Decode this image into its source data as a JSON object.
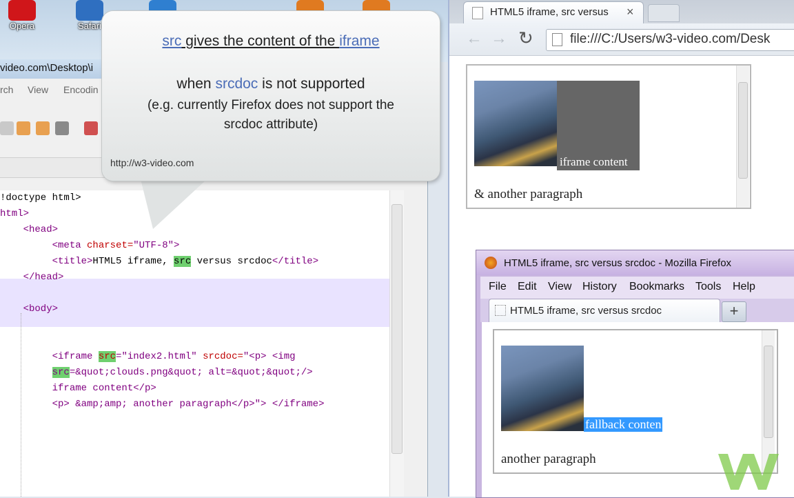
{
  "desktop": {
    "icons": [
      {
        "label": "Opera",
        "color": "#d0161a"
      },
      {
        "label": "Safari",
        "color": "#2f6fc0"
      },
      {
        "label": "",
        "color": "#2f7fd0"
      },
      {
        "label": "",
        "color": "#e07a20"
      },
      {
        "label": "",
        "color": "#e07a20"
      }
    ]
  },
  "editor": {
    "path": "video.com\\Desktop\\i",
    "menu": [
      "rch",
      "View",
      "Encodin"
    ],
    "code_lines": [
      {
        "parts": [
          {
            "t": "!doctype html>",
            "c": "txt"
          }
        ]
      },
      {
        "parts": [
          {
            "t": "html>",
            "c": "tag"
          }
        ]
      },
      {
        "parts": [
          {
            "t": "    <head>",
            "c": "tag"
          }
        ]
      },
      {
        "parts": [
          {
            "t": "         <meta ",
            "c": "tag"
          },
          {
            "t": "charset=",
            "c": "attr"
          },
          {
            "t": "\"UTF-8\">",
            "c": "val"
          }
        ]
      },
      {
        "parts": [
          {
            "t": "         <title>",
            "c": "tag"
          },
          {
            "t": "HTML5 iframe, ",
            "c": "txt"
          },
          {
            "t": "src",
            "c": "txt hl"
          },
          {
            "t": " versus srcdoc",
            "c": "txt"
          },
          {
            "t": "</title>",
            "c": "tag"
          }
        ]
      },
      {
        "parts": [
          {
            "t": "    </head>",
            "c": "tag"
          }
        ]
      },
      {
        "parts": [
          {
            "t": "",
            "c": "txt"
          }
        ]
      },
      {
        "parts": [
          {
            "t": "    <body>",
            "c": "tag"
          }
        ]
      },
      {
        "parts": [
          {
            "t": "",
            "c": "txt"
          }
        ]
      },
      {
        "parts": [
          {
            "t": "",
            "c": "txt"
          }
        ]
      },
      {
        "parts": [
          {
            "t": "         <iframe ",
            "c": "tag"
          },
          {
            "t": "src",
            "c": "attr hl"
          },
          {
            "t": "=\"index2.html\" ",
            "c": "val"
          },
          {
            "t": "srcdoc=",
            "c": "attr"
          },
          {
            "t": "\"<p> <img",
            "c": "val"
          }
        ]
      },
      {
        "parts": [
          {
            "t": "         ",
            "c": "txt"
          },
          {
            "t": "src",
            "c": "val hl"
          },
          {
            "t": "=&quot;clouds.png&quot; alt=&quot;&quot;/>",
            "c": "val"
          }
        ]
      },
      {
        "parts": [
          {
            "t": "         iframe content</p>",
            "c": "val"
          }
        ]
      },
      {
        "parts": [
          {
            "t": "         <p> &amp;amp; another paragraph</p>\"> </iframe>",
            "c": "val"
          }
        ]
      }
    ]
  },
  "callout": {
    "line1_a": "src",
    "line1_b": " gives the content of the ",
    "line1_c": "iframe",
    "line2_a": "when ",
    "line2_b": "srcdoc",
    "line2_c": " is not supported",
    "line3": "(e.g. currently Firefox does not support the",
    "line4": "srcdoc attribute)",
    "credit": "http://w3-video.com"
  },
  "chrome": {
    "tab_title": "HTML5 iframe, src versus",
    "tab_close": "×",
    "url": "file:///C:/Users/w3-video.com/Desk",
    "iframe_caption": "iframe content",
    "paragraph": "& another paragraph"
  },
  "firefox": {
    "title": "HTML5 iframe, src versus srcdoc - Mozilla Firefox",
    "menu": [
      "File",
      "Edit",
      "View",
      "History",
      "Bookmarks",
      "Tools",
      "Help"
    ],
    "tab_title": "HTML5 iframe, src versus srcdoc",
    "new_tab": "+",
    "selected_text": "fallback conten",
    "paragraph": "another paragraph"
  },
  "colors": {
    "accent_blue": "#4b6db7",
    "selection": "#3399ff",
    "logo_green": "#7fc94a"
  }
}
